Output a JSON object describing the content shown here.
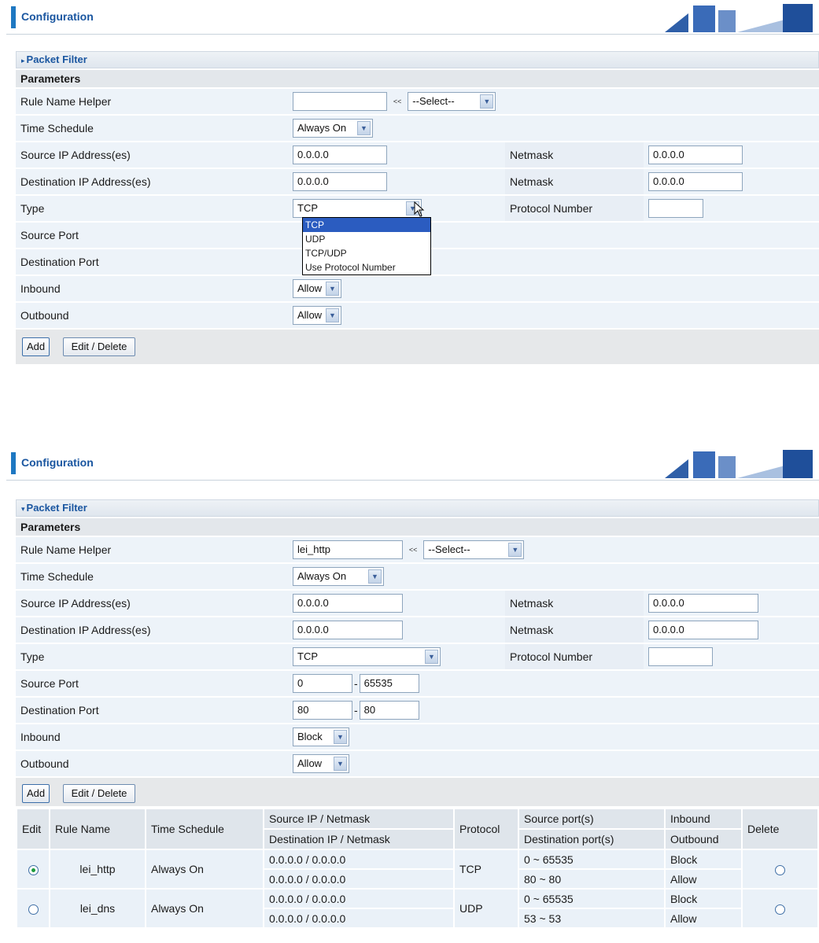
{
  "header": {
    "title": "Configuration"
  },
  "section": {
    "title": "Packet Filter"
  },
  "params": {
    "heading": "Parameters",
    "labels": {
      "rule_name": "Rule Name  Helper",
      "time_schedule": "Time Schedule",
      "src_ip": "Source IP Address(es)",
      "dst_ip": "Destination IP Address(es)",
      "type": "Type",
      "src_port": "Source Port",
      "dst_port": "Destination Port",
      "inbound": "Inbound",
      "outbound": "Outbound",
      "netmask": "Netmask",
      "protocol_number": "Protocol Number"
    },
    "helper_arrow": "<<",
    "helper_select": "--Select--"
  },
  "buttons": {
    "add": "Add",
    "edit_delete": "Edit / Delete"
  },
  "screen1": {
    "rule_name": "",
    "time_schedule": "Always On",
    "src_ip": "0.0.0.0",
    "src_netmask": "0.0.0.0",
    "dst_ip": "0.0.0.0",
    "dst_netmask": "0.0.0.0",
    "type": "TCP",
    "protocol_number": "",
    "inbound": "Allow",
    "outbound": "Allow",
    "type_options": [
      "TCP",
      "UDP",
      "TCP/UDP",
      "Use Protocol Number"
    ],
    "highlighted_option": "TCP"
  },
  "screen2": {
    "rule_name": "lei_http",
    "time_schedule": "Always On",
    "src_ip": "0.0.0.0",
    "src_netmask": "0.0.0.0",
    "dst_ip": "0.0.0.0",
    "dst_netmask": "0.0.0.0",
    "type": "TCP",
    "protocol_number": "",
    "src_port_start": "0",
    "src_port_end": "65535",
    "dst_port_start": "80",
    "dst_port_end": "80",
    "port_dash": "-",
    "inbound": "Block",
    "outbound": "Allow"
  },
  "rules_table": {
    "headers": {
      "edit": "Edit",
      "rule_name": "Rule Name",
      "time_schedule": "Time Schedule",
      "src_ip_netmask": "Source IP / Netmask",
      "dst_ip_netmask": "Destination IP / Netmask",
      "protocol": "Protocol",
      "src_ports": "Source port(s)",
      "dst_ports": "Destination port(s)",
      "inbound": "Inbound",
      "outbound": "Outbound",
      "delete": "Delete"
    },
    "rows": [
      {
        "edit_selected": true,
        "name": "lei_http",
        "schedule": "Always On",
        "src": "0.0.0.0 / 0.0.0.0",
        "dst": "0.0.0.0 / 0.0.0.0",
        "protocol": "TCP",
        "src_ports": "0 ~ 65535",
        "dst_ports": "80 ~ 80",
        "inbound": "Block",
        "outbound": "Allow"
      },
      {
        "edit_selected": false,
        "name": "lei_dns",
        "schedule": "Always On",
        "src": "0.0.0.0 / 0.0.0.0",
        "dst": "0.0.0.0 / 0.0.0.0",
        "protocol": "UDP",
        "src_ports": "0 ~ 65535",
        "dst_ports": "53 ~ 53",
        "inbound": "Block",
        "outbound": "Allow"
      }
    ]
  }
}
